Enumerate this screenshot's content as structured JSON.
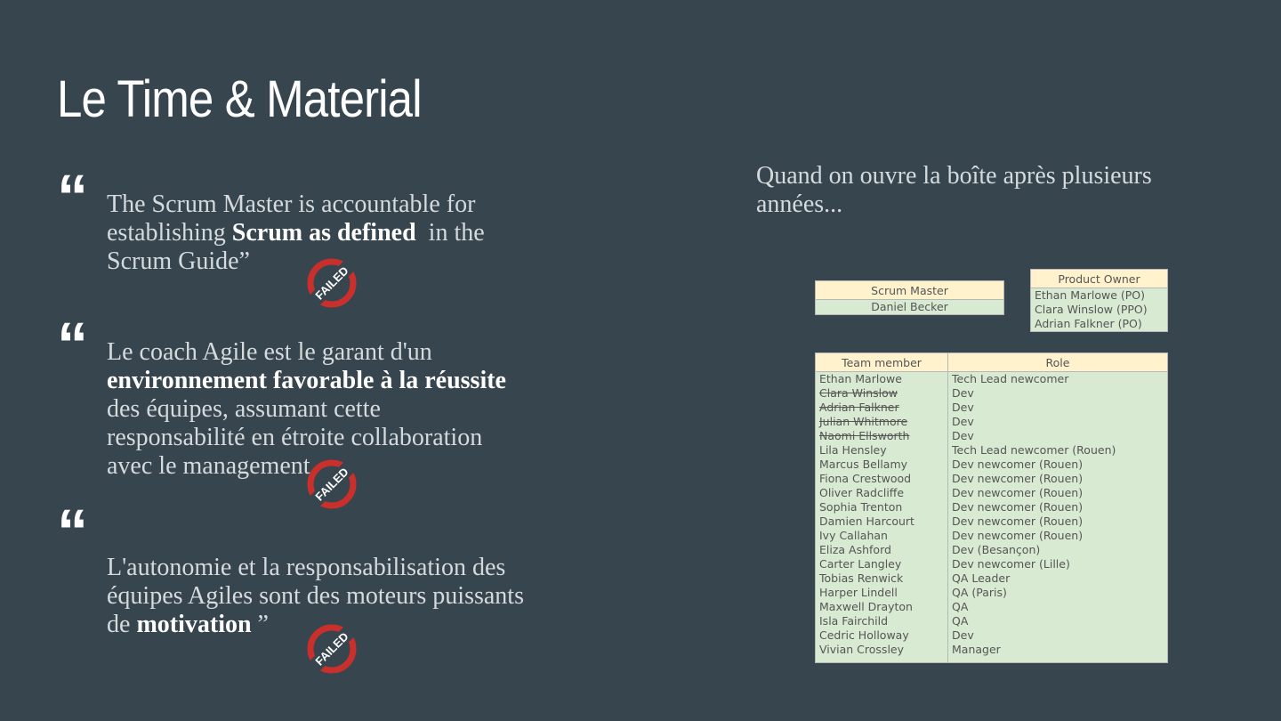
{
  "slide": {
    "title": "Le Time & Material",
    "quote_mark": "“",
    "quotes": [
      {
        "line1": "The Scrum Master is accountable for",
        "line2_pre": "establishing ",
        "line2_bold": "Scrum as defined",
        "line2_post": "  in the",
        "line3": "Scrum Guide”"
      },
      {
        "line1": "Le coach Agile est le garant d'un",
        "line2_bold": "environnement favorable à la réussite",
        "line3": "des équipes, assumant cette",
        "line4": "responsabilité en étroite collaboration",
        "line5": "avec le management"
      },
      {
        "line1": "L'autonomie et la responsabilisation des",
        "line2": "équipes Agiles sont des moteurs puissants",
        "line3_pre": "de ",
        "line3_bold": "motivation",
        "line3_post": " ”"
      }
    ],
    "stamp_label": "FAILED",
    "right_text": "Quand on ouvre la boîte après plusieurs années..."
  },
  "scrum_master": {
    "header": "Scrum Master",
    "name": "Daniel Becker"
  },
  "product_owner": {
    "header": "Product Owner",
    "names": [
      "Ethan Marlowe (PO)",
      "Clara Winslow (PPO)",
      "Adrian Falkner (PO)"
    ]
  },
  "team": {
    "headers": [
      "Team member",
      "Role"
    ],
    "rows": [
      {
        "name": "Ethan Marlowe",
        "role": "Tech Lead newcomer",
        "struck": false
      },
      {
        "name": "Clara Winslow",
        "role": "Dev",
        "struck": true
      },
      {
        "name": "Adrian Falkner",
        "role": "Dev",
        "struck": true
      },
      {
        "name": "Julian Whitmore",
        "role": "Dev",
        "struck": true
      },
      {
        "name": "Naomi Ellsworth",
        "role": "Dev",
        "struck": true
      },
      {
        "name": "Lila Hensley",
        "role": "Tech Lead newcomer (Rouen)",
        "struck": false
      },
      {
        "name": "Marcus Bellamy",
        "role": "Dev newcomer (Rouen)",
        "struck": false
      },
      {
        "name": "Fiona Crestwood",
        "role": "Dev newcomer (Rouen)",
        "struck": false
      },
      {
        "name": "Oliver Radcliffe",
        "role": "Dev newcomer (Rouen)",
        "struck": false
      },
      {
        "name": "Sophia Trenton",
        "role": "Dev newcomer (Rouen)",
        "struck": false
      },
      {
        "name": "Damien Harcourt",
        "role": "Dev newcomer (Rouen)",
        "struck": false
      },
      {
        "name": "Ivy Callahan",
        "role": "Dev newcomer (Rouen)",
        "struck": false
      },
      {
        "name": "Eliza Ashford",
        "role": "Dev (Besançon)",
        "struck": false
      },
      {
        "name": "Carter Langley",
        "role": "Dev newcomer (Lille)",
        "struck": false
      },
      {
        "name": "Tobias Renwick",
        "role": "QA Leader",
        "struck": false
      },
      {
        "name": "Harper Lindell",
        "role": "QA (Paris)",
        "struck": false
      },
      {
        "name": "Maxwell Drayton",
        "role": "QA",
        "struck": false
      },
      {
        "name": "Isla Fairchild",
        "role": "QA",
        "struck": false
      },
      {
        "name": "Cedric Holloway",
        "role": "Dev",
        "struck": false
      },
      {
        "name": "Vivian Crossley",
        "role": "Manager",
        "struck": false
      }
    ]
  }
}
